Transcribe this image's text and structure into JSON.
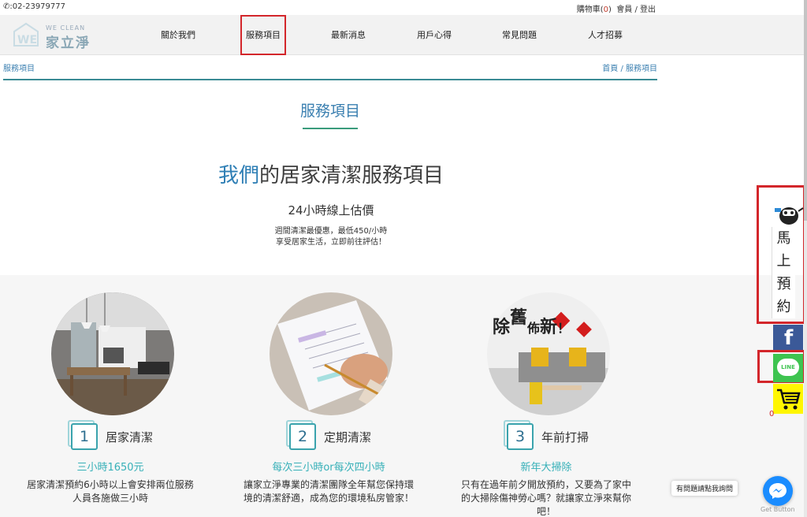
{
  "topbar": {
    "phone": ":02-23979777",
    "cart_label": "購物車(",
    "cart_count": "0",
    "cart_close": ")",
    "account": "會員 / 登出"
  },
  "logo": {
    "en": "WE CLEAN",
    "zh": "家立淨"
  },
  "nav": {
    "items": [
      {
        "label": "關於我們"
      },
      {
        "label": "服務項目"
      },
      {
        "label": "最新消息"
      },
      {
        "label": "用戶心得"
      },
      {
        "label": "常見問題"
      },
      {
        "label": "人才招募"
      }
    ]
  },
  "breadcrumb": {
    "current": "服務項目",
    "trail": "首頁 / 服務項目"
  },
  "page": {
    "title": "服務項目",
    "headline_highlight": "我們",
    "headline_rest": "的居家清潔服務項目",
    "subhead": "24小時線上估價",
    "line1": "週間清潔最優惠，最低450/小時",
    "line2": "享受居家生活，立即前往評估！"
  },
  "services": [
    {
      "num": "1",
      "name": "居家清潔",
      "price": "三小時1650元",
      "desc": "居家清潔預約6小時以上會安排兩位服務人員各施做三小時"
    },
    {
      "num": "2",
      "name": "定期清潔",
      "price": "每次三小時or每次四小時",
      "desc": "讓家立淨專業的清潔團隊全年幫您保持環境的清潔舒適，成為您的環境私房管家！"
    },
    {
      "num": "3",
      "name": "年前打掃",
      "price": "新年大掃除",
      "desc": "只有在過年前夕開放預約，又要為了家中的大掃除傷神勞心嗎？就讓家立淨來幫你吧！"
    }
  ],
  "poster": {
    "text1": "除",
    "text2": "舊",
    "text3": "佈",
    "text4": "新",
    "text5": "！"
  },
  "widgets": {
    "booking": [
      "馬",
      "上",
      "預",
      "約"
    ],
    "facebook": "f",
    "line": "LINE",
    "cart_count": "0",
    "help": "有問題請點我詢問",
    "get_button": "Get Button"
  },
  "colors": {
    "accent": "#3a7fb0",
    "teal": "#36b0b8",
    "highlight_border": "#d3262b"
  }
}
